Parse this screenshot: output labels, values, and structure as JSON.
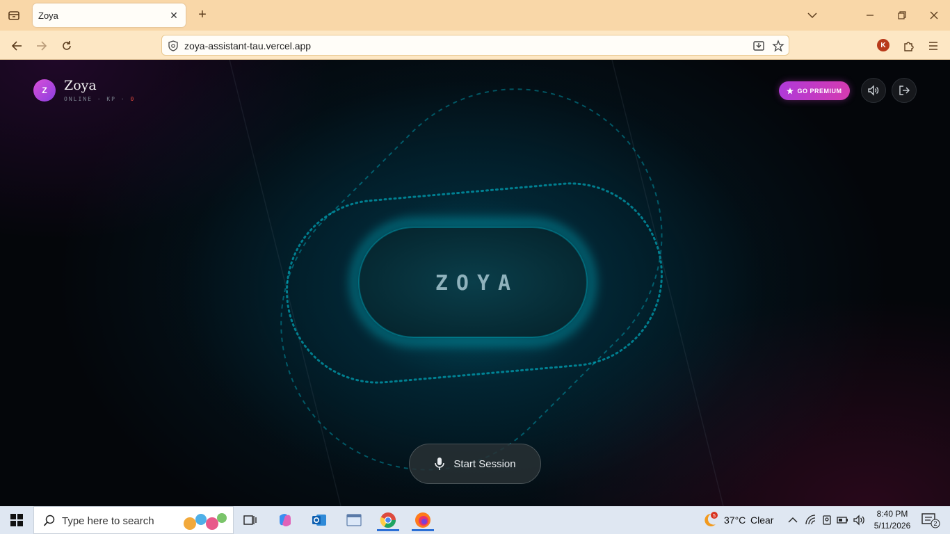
{
  "browser": {
    "tab_title": "Zoya",
    "url": "zoya-assistant-tau.vercel.app",
    "profile_initial": "K"
  },
  "app": {
    "avatar_letter": "Z",
    "name": "Zoya",
    "status_prefix": "ONLINE · KP · ",
    "kp_value": "0",
    "premium_label": "GO PREMIUM",
    "orb_label": "ZOYA",
    "start_label": "Start Session",
    "accent_color": "#00a8c0",
    "premium_color": "#c03ad0"
  },
  "taskbar": {
    "search_placeholder": "Type here to search",
    "weather_temp": "37°C",
    "weather_desc": "Clear",
    "weather_badge": "5",
    "time": "8:40 PM",
    "date": "5/11/2026",
    "notifications": "2"
  }
}
